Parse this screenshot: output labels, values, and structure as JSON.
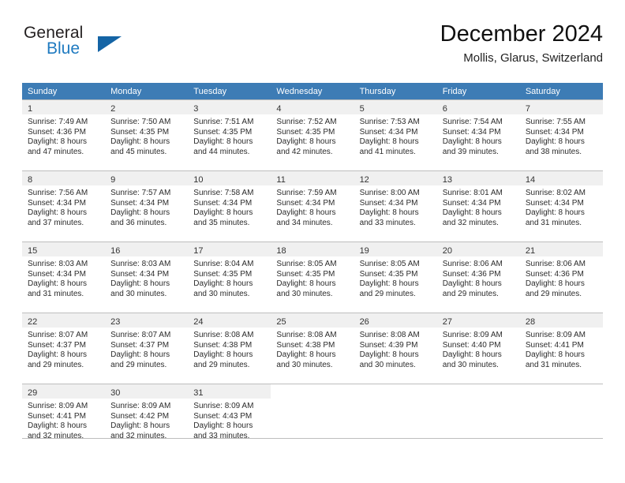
{
  "logo": {
    "word_top": "General",
    "word_bottom": "Blue",
    "triangle_color": "#1464a5",
    "blue_color": "#1f7ac0"
  },
  "header": {
    "title": "December 2024",
    "subtitle": "Mollis, Glarus, Switzerland",
    "header_bg": "#3d7cb5"
  },
  "weekdays": [
    "Sunday",
    "Monday",
    "Tuesday",
    "Wednesday",
    "Thursday",
    "Friday",
    "Saturday"
  ],
  "weeks": [
    [
      {
        "day": "1",
        "sunrise": "Sunrise: 7:49 AM",
        "sunset": "Sunset: 4:36 PM",
        "daylight1": "Daylight: 8 hours",
        "daylight2": "and 47 minutes."
      },
      {
        "day": "2",
        "sunrise": "Sunrise: 7:50 AM",
        "sunset": "Sunset: 4:35 PM",
        "daylight1": "Daylight: 8 hours",
        "daylight2": "and 45 minutes."
      },
      {
        "day": "3",
        "sunrise": "Sunrise: 7:51 AM",
        "sunset": "Sunset: 4:35 PM",
        "daylight1": "Daylight: 8 hours",
        "daylight2": "and 44 minutes."
      },
      {
        "day": "4",
        "sunrise": "Sunrise: 7:52 AM",
        "sunset": "Sunset: 4:35 PM",
        "daylight1": "Daylight: 8 hours",
        "daylight2": "and 42 minutes."
      },
      {
        "day": "5",
        "sunrise": "Sunrise: 7:53 AM",
        "sunset": "Sunset: 4:34 PM",
        "daylight1": "Daylight: 8 hours",
        "daylight2": "and 41 minutes."
      },
      {
        "day": "6",
        "sunrise": "Sunrise: 7:54 AM",
        "sunset": "Sunset: 4:34 PM",
        "daylight1": "Daylight: 8 hours",
        "daylight2": "and 39 minutes."
      },
      {
        "day": "7",
        "sunrise": "Sunrise: 7:55 AM",
        "sunset": "Sunset: 4:34 PM",
        "daylight1": "Daylight: 8 hours",
        "daylight2": "and 38 minutes."
      }
    ],
    [
      {
        "day": "8",
        "sunrise": "Sunrise: 7:56 AM",
        "sunset": "Sunset: 4:34 PM",
        "daylight1": "Daylight: 8 hours",
        "daylight2": "and 37 minutes."
      },
      {
        "day": "9",
        "sunrise": "Sunrise: 7:57 AM",
        "sunset": "Sunset: 4:34 PM",
        "daylight1": "Daylight: 8 hours",
        "daylight2": "and 36 minutes."
      },
      {
        "day": "10",
        "sunrise": "Sunrise: 7:58 AM",
        "sunset": "Sunset: 4:34 PM",
        "daylight1": "Daylight: 8 hours",
        "daylight2": "and 35 minutes."
      },
      {
        "day": "11",
        "sunrise": "Sunrise: 7:59 AM",
        "sunset": "Sunset: 4:34 PM",
        "daylight1": "Daylight: 8 hours",
        "daylight2": "and 34 minutes."
      },
      {
        "day": "12",
        "sunrise": "Sunrise: 8:00 AM",
        "sunset": "Sunset: 4:34 PM",
        "daylight1": "Daylight: 8 hours",
        "daylight2": "and 33 minutes."
      },
      {
        "day": "13",
        "sunrise": "Sunrise: 8:01 AM",
        "sunset": "Sunset: 4:34 PM",
        "daylight1": "Daylight: 8 hours",
        "daylight2": "and 32 minutes."
      },
      {
        "day": "14",
        "sunrise": "Sunrise: 8:02 AM",
        "sunset": "Sunset: 4:34 PM",
        "daylight1": "Daylight: 8 hours",
        "daylight2": "and 31 minutes."
      }
    ],
    [
      {
        "day": "15",
        "sunrise": "Sunrise: 8:03 AM",
        "sunset": "Sunset: 4:34 PM",
        "daylight1": "Daylight: 8 hours",
        "daylight2": "and 31 minutes."
      },
      {
        "day": "16",
        "sunrise": "Sunrise: 8:03 AM",
        "sunset": "Sunset: 4:34 PM",
        "daylight1": "Daylight: 8 hours",
        "daylight2": "and 30 minutes."
      },
      {
        "day": "17",
        "sunrise": "Sunrise: 8:04 AM",
        "sunset": "Sunset: 4:35 PM",
        "daylight1": "Daylight: 8 hours",
        "daylight2": "and 30 minutes."
      },
      {
        "day": "18",
        "sunrise": "Sunrise: 8:05 AM",
        "sunset": "Sunset: 4:35 PM",
        "daylight1": "Daylight: 8 hours",
        "daylight2": "and 30 minutes."
      },
      {
        "day": "19",
        "sunrise": "Sunrise: 8:05 AM",
        "sunset": "Sunset: 4:35 PM",
        "daylight1": "Daylight: 8 hours",
        "daylight2": "and 29 minutes."
      },
      {
        "day": "20",
        "sunrise": "Sunrise: 8:06 AM",
        "sunset": "Sunset: 4:36 PM",
        "daylight1": "Daylight: 8 hours",
        "daylight2": "and 29 minutes."
      },
      {
        "day": "21",
        "sunrise": "Sunrise: 8:06 AM",
        "sunset": "Sunset: 4:36 PM",
        "daylight1": "Daylight: 8 hours",
        "daylight2": "and 29 minutes."
      }
    ],
    [
      {
        "day": "22",
        "sunrise": "Sunrise: 8:07 AM",
        "sunset": "Sunset: 4:37 PM",
        "daylight1": "Daylight: 8 hours",
        "daylight2": "and 29 minutes."
      },
      {
        "day": "23",
        "sunrise": "Sunrise: 8:07 AM",
        "sunset": "Sunset: 4:37 PM",
        "daylight1": "Daylight: 8 hours",
        "daylight2": "and 29 minutes."
      },
      {
        "day": "24",
        "sunrise": "Sunrise: 8:08 AM",
        "sunset": "Sunset: 4:38 PM",
        "daylight1": "Daylight: 8 hours",
        "daylight2": "and 29 minutes."
      },
      {
        "day": "25",
        "sunrise": "Sunrise: 8:08 AM",
        "sunset": "Sunset: 4:38 PM",
        "daylight1": "Daylight: 8 hours",
        "daylight2": "and 30 minutes."
      },
      {
        "day": "26",
        "sunrise": "Sunrise: 8:08 AM",
        "sunset": "Sunset: 4:39 PM",
        "daylight1": "Daylight: 8 hours",
        "daylight2": "and 30 minutes."
      },
      {
        "day": "27",
        "sunrise": "Sunrise: 8:09 AM",
        "sunset": "Sunset: 4:40 PM",
        "daylight1": "Daylight: 8 hours",
        "daylight2": "and 30 minutes."
      },
      {
        "day": "28",
        "sunrise": "Sunrise: 8:09 AM",
        "sunset": "Sunset: 4:41 PM",
        "daylight1": "Daylight: 8 hours",
        "daylight2": "and 31 minutes."
      }
    ],
    [
      {
        "day": "29",
        "sunrise": "Sunrise: 8:09 AM",
        "sunset": "Sunset: 4:41 PM",
        "daylight1": "Daylight: 8 hours",
        "daylight2": "and 32 minutes."
      },
      {
        "day": "30",
        "sunrise": "Sunrise: 8:09 AM",
        "sunset": "Sunset: 4:42 PM",
        "daylight1": "Daylight: 8 hours",
        "daylight2": "and 32 minutes."
      },
      {
        "day": "31",
        "sunrise": "Sunrise: 8:09 AM",
        "sunset": "Sunset: 4:43 PM",
        "daylight1": "Daylight: 8 hours",
        "daylight2": "and 33 minutes."
      },
      {
        "day": "",
        "sunrise": "",
        "sunset": "",
        "daylight1": "",
        "daylight2": ""
      },
      {
        "day": "",
        "sunrise": "",
        "sunset": "",
        "daylight1": "",
        "daylight2": ""
      },
      {
        "day": "",
        "sunrise": "",
        "sunset": "",
        "daylight1": "",
        "daylight2": ""
      },
      {
        "day": "",
        "sunrise": "",
        "sunset": "",
        "daylight1": "",
        "daylight2": ""
      }
    ]
  ]
}
